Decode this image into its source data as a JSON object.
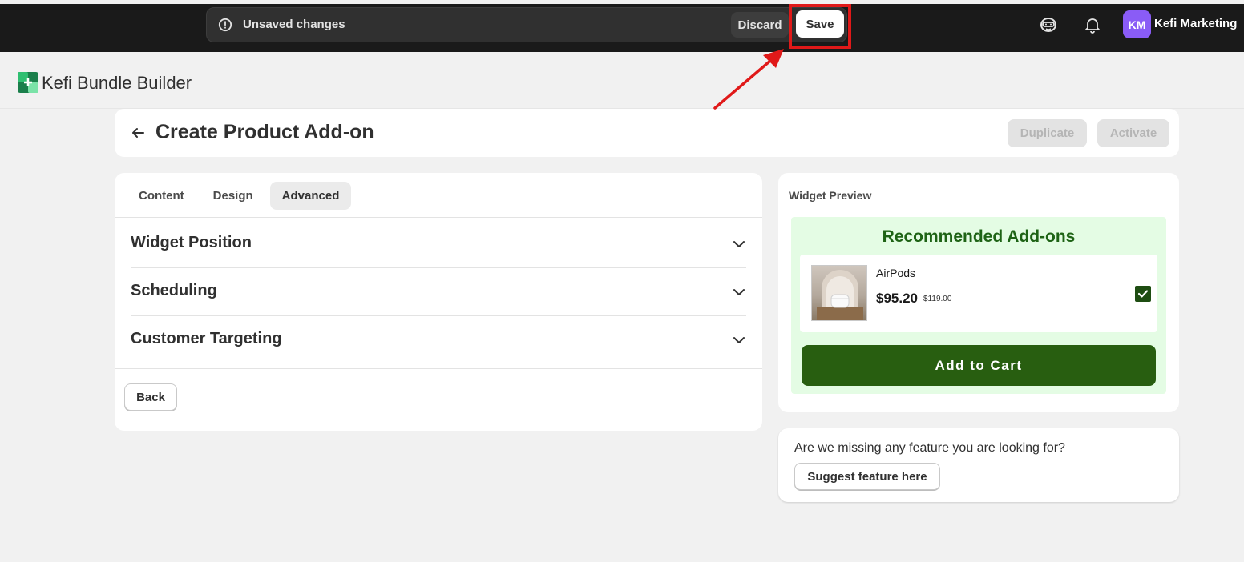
{
  "topbar": {
    "unsaved_text": "Unsaved changes",
    "discard_label": "Discard",
    "save_label": "Save",
    "avatar_initials": "KM",
    "store_name": "Kefi Marketing",
    "icons": [
      "alert-circle-icon",
      "sidekick-icon",
      "bell-icon"
    ]
  },
  "app": {
    "title": "Kefi Bundle Builder",
    "logo_icon": "kefi-logo-icon"
  },
  "page": {
    "title": "Create Product Add-on",
    "duplicate_label": "Duplicate",
    "activate_label": "Activate"
  },
  "tabs": [
    {
      "label": "Content",
      "active": false
    },
    {
      "label": "Design",
      "active": false
    },
    {
      "label": "Advanced",
      "active": true
    }
  ],
  "sections": [
    {
      "label": "Widget Position"
    },
    {
      "label": "Scheduling"
    },
    {
      "label": "Customer Targeting"
    }
  ],
  "back_label": "Back",
  "preview": {
    "label": "Widget Preview",
    "title": "Recommended Add-ons",
    "product": {
      "name": "AirPods",
      "price": "$95.20",
      "compare_price": "$119.00",
      "checked": true
    },
    "cart_label": "Add to Cart"
  },
  "feature": {
    "text": "Are we missing any feature you are looking for?",
    "button_label": "Suggest feature here"
  },
  "colors": {
    "topbar_bg": "#1a1a1a",
    "highlight": "#e01919",
    "widget_title": "#1e6315",
    "widget_bg": "#e4fce4",
    "cart_button": "#285e10",
    "avatar": "#8a5cf6"
  }
}
